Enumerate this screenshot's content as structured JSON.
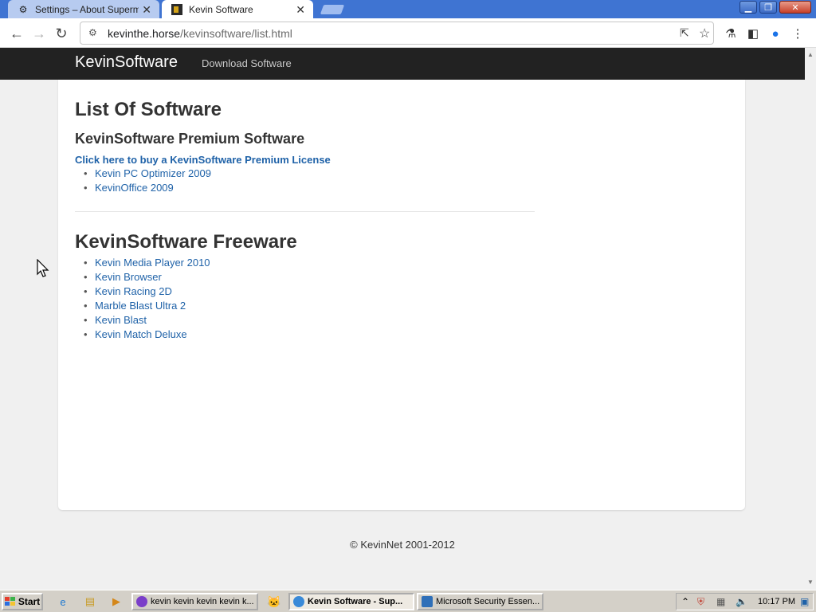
{
  "browser": {
    "tabs": [
      {
        "title": "Settings – About Supermium",
        "icon": "gear-icon",
        "active": false
      },
      {
        "title": "Kevin Software",
        "icon": "site-favicon",
        "active": true
      }
    ],
    "address": {
      "host": "kevinthe.horse",
      "path": "/kevinsoftware/list.html"
    }
  },
  "site": {
    "brand": "KevinSoftware",
    "nav": [
      "Download Software"
    ]
  },
  "content": {
    "title": "List Of Software",
    "premium": {
      "heading": "KevinSoftware Premium Software",
      "buy_link": "Click here to buy a KevinSoftware Premium License",
      "items": [
        "Kevin PC Optimizer 2009",
        "KevinOffice 2009"
      ]
    },
    "freeware": {
      "heading": "KevinSoftware Freeware",
      "items": [
        "Kevin Media Player 2010",
        "Kevin Browser",
        "Kevin Racing 2D",
        "Marble Blast Ultra 2",
        "Kevin Blast",
        "Kevin Match Deluxe"
      ]
    }
  },
  "footer": "© KevinNet 2001-2012",
  "taskbar": {
    "start": "Start",
    "tasks": [
      {
        "label": "kevin kevin kevin kevin k...",
        "icon": "browser-icon"
      },
      {
        "label": "",
        "icon": "cat-icon"
      },
      {
        "label": "Kevin Software - Sup...",
        "icon": "browser-icon",
        "active": true
      },
      {
        "label": "Microsoft Security Essen...",
        "icon": "security-icon"
      }
    ],
    "clock": "10:17 PM"
  },
  "colors": {
    "tabstrip": "#3f74d2",
    "navbar": "#222222",
    "link": "#1f62a8",
    "panel": "#ffffff",
    "page_bg": "#f0f0f0"
  }
}
